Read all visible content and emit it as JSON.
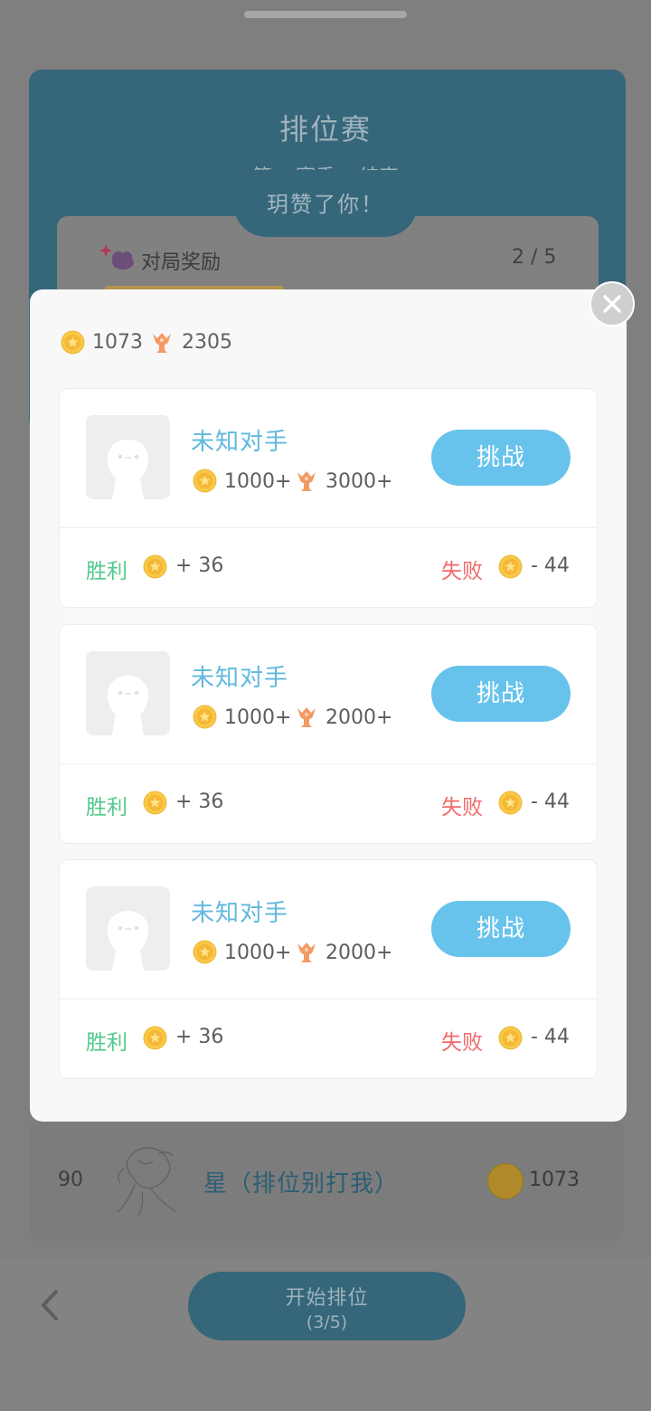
{
  "background": {
    "title": "排位赛",
    "subtitle": "第 ▯ 赛季 ▯ 结束",
    "toast": "玥赞了你！",
    "reward": {
      "label": "对局奖励",
      "count": "2 / 5"
    },
    "rank_row": {
      "rank": "90",
      "name": "星（排位别打我）",
      "coins": "1073"
    },
    "start_button": {
      "label": "开始排位",
      "sub": "(3/5)"
    }
  },
  "modal": {
    "stats": {
      "coins": "1073",
      "trophies": "2305"
    },
    "opponents": [
      {
        "name": "未知对手",
        "coin_req": "1000+",
        "trophy_req": "3000+",
        "button": "挑战",
        "win_label": "胜利",
        "win_value": "+ 36",
        "lose_label": "失败",
        "lose_value": "- 44"
      },
      {
        "name": "未知对手",
        "coin_req": "1000+",
        "trophy_req": "2000+",
        "button": "挑战",
        "win_label": "胜利",
        "win_value": "+ 36",
        "lose_label": "失败",
        "lose_value": "- 44"
      },
      {
        "name": "未知对手",
        "coin_req": "1000+",
        "trophy_req": "2000+",
        "button": "挑战",
        "win_label": "胜利",
        "win_value": "+ 36",
        "lose_label": "失败",
        "lose_value": "- 44"
      }
    ]
  },
  "icons": {
    "coin": "coin-icon",
    "trophy": "trophy-icon",
    "close": "close-icon",
    "back": "chevron-left-icon",
    "avatar": "avatar-placeholder-icon",
    "reward": "cloud-sparkle-icon"
  },
  "colors": {
    "accent_blue": "#68c3ec",
    "win_green": "#52c98b",
    "lose_red": "#f06a6a",
    "coin_gold": "#f7c948",
    "trophy_orange": "#f39a64"
  }
}
